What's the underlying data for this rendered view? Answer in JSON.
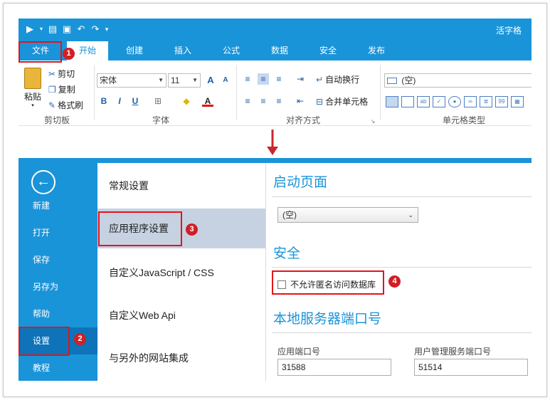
{
  "ribbon": {
    "app_title": "活字格",
    "tabs": [
      "文件",
      "开始",
      "创建",
      "插入",
      "公式",
      "数据",
      "安全",
      "发布"
    ],
    "clipboard": {
      "paste": "粘贴",
      "cut": "剪切",
      "copy": "复制",
      "format_painter": "格式刷",
      "group": "剪切板"
    },
    "font": {
      "name": "宋体",
      "size": "11",
      "bold": "B",
      "italic": "I",
      "underline": "U",
      "grow": "A",
      "shrink": "A",
      "font_color": "A",
      "group": "字体"
    },
    "alignment": {
      "wrap": "自动换行",
      "merge": "合并单元格",
      "group": "对齐方式"
    },
    "cell_type": {
      "value": "(空)",
      "group": "单元格类型"
    }
  },
  "backstage": {
    "menu": [
      "新建",
      "打开",
      "保存",
      "另存为",
      "帮助",
      "设置",
      "教程"
    ],
    "settings_nav": [
      "常规设置",
      "应用程序设置",
      "自定义JavaScript / CSS",
      "自定义Web Api",
      "与另外的网站集成"
    ],
    "startup": {
      "title": "启动页面",
      "selected": "(空)"
    },
    "security": {
      "title": "安全",
      "checkbox_label": "不允许匿名访问数据库"
    },
    "port": {
      "title": "本地服务器端口号",
      "app_port_label": "应用端口号",
      "app_port_value": "31588",
      "user_port_label": "用户管理服务端口号",
      "user_port_value": "51514"
    }
  },
  "badges": [
    "1",
    "2",
    "3",
    "4"
  ],
  "colors": {
    "accent": "#1a94d9",
    "highlight": "#e3141b",
    "selected_nav": "#c6d2e2"
  }
}
